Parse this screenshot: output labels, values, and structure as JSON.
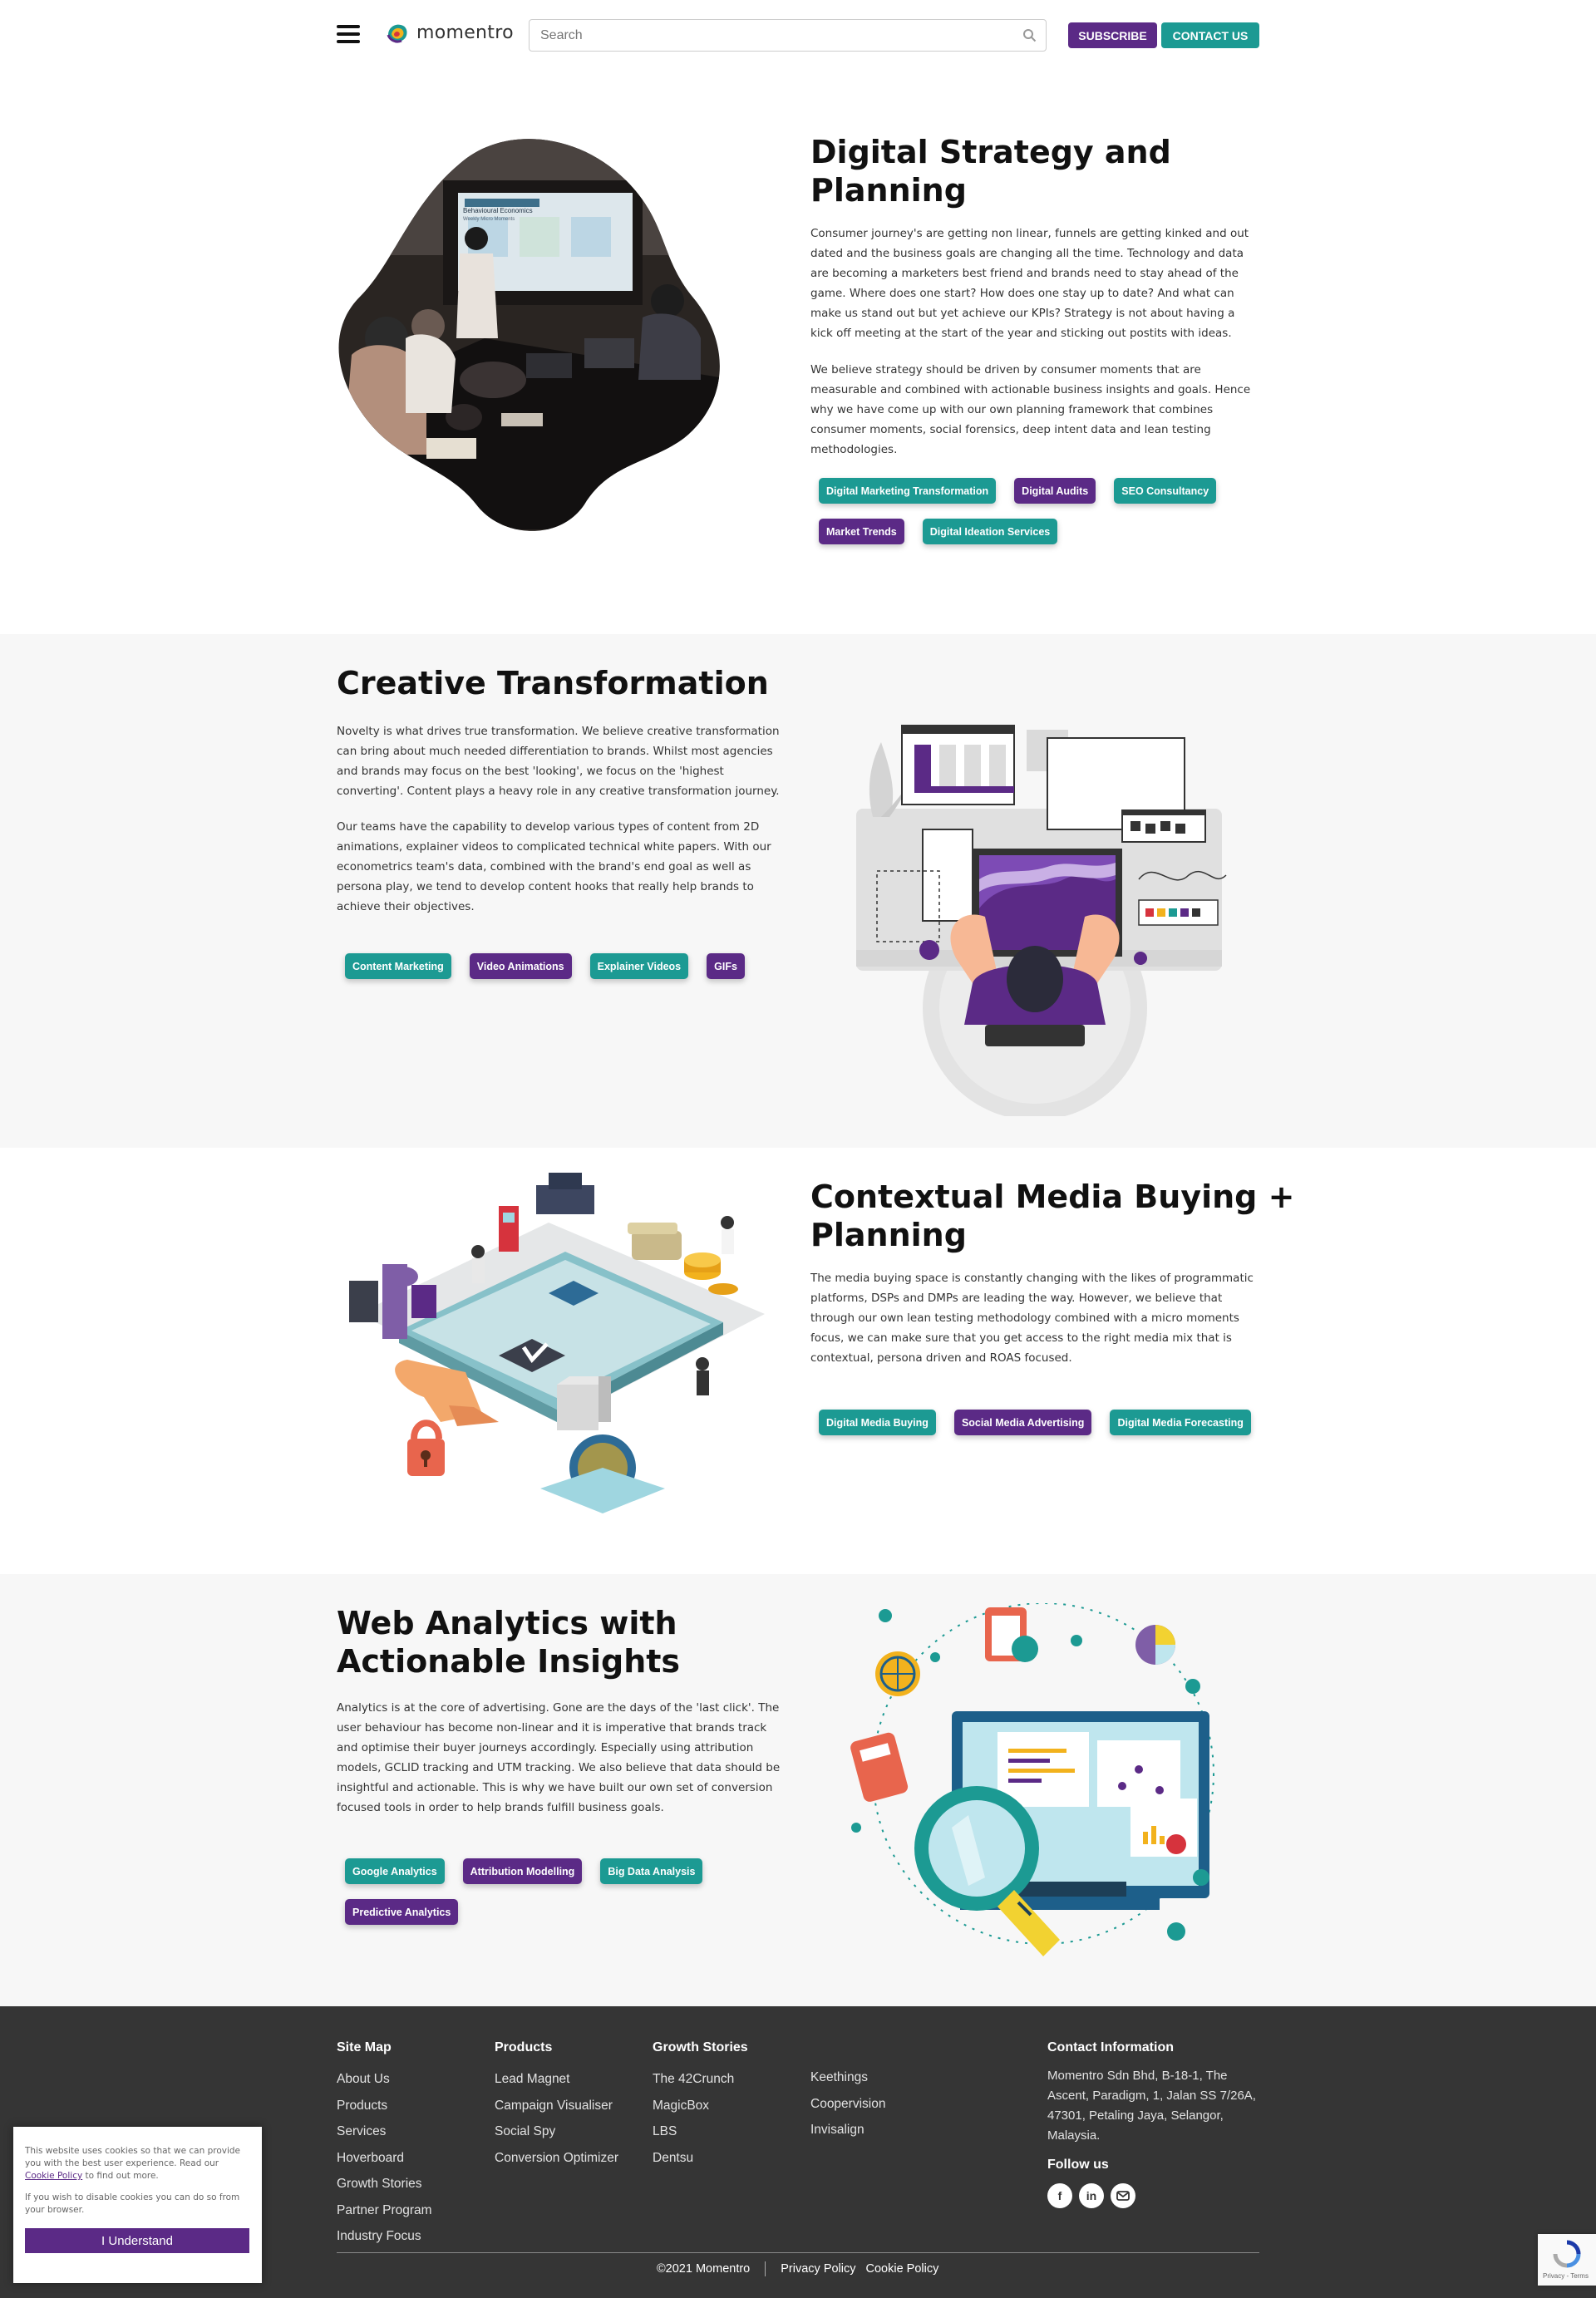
{
  "header": {
    "logo_text": "momentro",
    "search_placeholder": "Search",
    "subscribe_label": "SUBSCRIBE",
    "contact_label": "CONTACT US"
  },
  "sections": [
    {
      "title_line1": "Digital Strategy and",
      "title_line2": "Planning",
      "paragraphs": [
        "Consumer journey's are getting non linear, funnels are getting kinked and out dated and the business goals are changing all the time. Technology and data are becoming a marketers best friend and brands need to stay ahead of the game. Where does one start? How does one stay up to date? And what can make us stand out but yet achieve our KPIs? Strategy is not about having a kick off meeting at the start of the year and sticking out postits with ideas.",
        "We believe strategy should be driven by consumer moments that are measurable and combined with actionable business insights and goals. Hence why we have come up with our own planning framework that combines consumer moments, social forensics, deep intent data and lean testing methodologies."
      ],
      "tags": [
        "Digital Marketing Transformation",
        "Digital Audits",
        "SEO Consultancy",
        "Market Trends",
        "Digital Ideation Services"
      ]
    },
    {
      "title_line1": "Creative Transformation",
      "paragraphs": [
        "Novelty is what drives true transformation. We believe creative transformation can bring about much needed differentiation to brands. Whilst most agencies and brands may focus on the best 'looking', we focus on the 'highest converting'. Content plays a heavy role in any creative transformation journey.",
        "Our teams have the capability to develop various types of content from 2D animations, explainer videos to complicated technical white papers. With our econometrics team's data, combined with the brand's end goal as well as persona play, we tend to develop content hooks that really help brands to achieve their objectives."
      ],
      "tags": [
        "Content Marketing",
        "Video Animations",
        "Explainer Videos",
        "GIFs"
      ]
    },
    {
      "title_line1": "Contextual Media Buying +",
      "title_line2": "Planning",
      "paragraphs": [
        "The media buying space is constantly changing with the likes of programmatic platforms, DSPs and DMPs are leading the way. However, we believe that through our own lean testing methodology combined with a micro moments focus, we can make sure that you get access to the right media mix that is contextual, persona driven and ROAS focused."
      ],
      "tags": [
        "Digital Media Buying",
        "Social Media Advertising",
        "Digital Media Forecasting"
      ]
    },
    {
      "title_line1": "Web Analytics with",
      "title_line2": "Actionable Insights",
      "paragraphs": [
        "Analytics is at the core of advertising. Gone are the days of the 'last click'. The user behaviour has become non-linear and it is imperative that brands track and optimise their buyer journeys accordingly. Especially using attribution models, GCLID tracking and UTM tracking. We also believe that data should be insightful and actionable. This is why we have built our own set of conversion focused tools in order to help brands fulfill business goals."
      ],
      "tags": [
        "Google Analytics",
        "Attribution Modelling",
        "Big Data Analysis",
        "Predictive Analytics"
      ]
    }
  ],
  "presentation_slide": {
    "title": "Behavioural Economics",
    "subtitle": "Weekly Micro Moments"
  },
  "footer": {
    "sitemap": {
      "heading": "Site Map",
      "links": [
        "About Us",
        "Products",
        "Services",
        "Hoverboard",
        "Growth Stories",
        "Partner Program",
        "Industry Focus"
      ]
    },
    "products": {
      "heading": "Products",
      "links": [
        "Lead Magnet",
        "Campaign Visualiser",
        "Social Spy",
        "Conversion Optimizer"
      ]
    },
    "growth": {
      "heading": "Growth Stories",
      "links": [
        "The 42Crunch",
        "MagicBox",
        "LBS",
        "Dentsu"
      ],
      "links2": [
        "Keethings",
        "Coopervision",
        "Invisalign"
      ]
    },
    "contact": {
      "heading": "Contact Information",
      "address": "Momentro Sdn Bhd, B-18-1, The Ascent, Paradigm, 1, Jalan SS 7/26A, 47301, Petaling Jaya, Selangor, Malaysia.",
      "follow_heading": "Follow us"
    },
    "copyright": "©2021 Momentro",
    "privacy": "Privacy Policy",
    "cookie_policy": "Cookie Policy"
  },
  "cookie_banner": {
    "text_before": "This website uses cookies so that we can provide you with the best user experience. Read our",
    "link": "Cookie Policy",
    "text_after": "to find out more.",
    "text2": "If you wish to disable cookies you can do so from your browser.",
    "button": "I Understand"
  },
  "recaptcha": {
    "text": "Privacy - Terms"
  },
  "colors": {
    "purple": "#5b2a86",
    "teal": "#1c9a93",
    "footer_bg": "#353535"
  },
  "icons": [
    "hamburger-menu-icon",
    "logo-icon",
    "search-icon",
    "facebook-icon",
    "linkedin-icon",
    "email-icon",
    "recaptcha-icon"
  ]
}
